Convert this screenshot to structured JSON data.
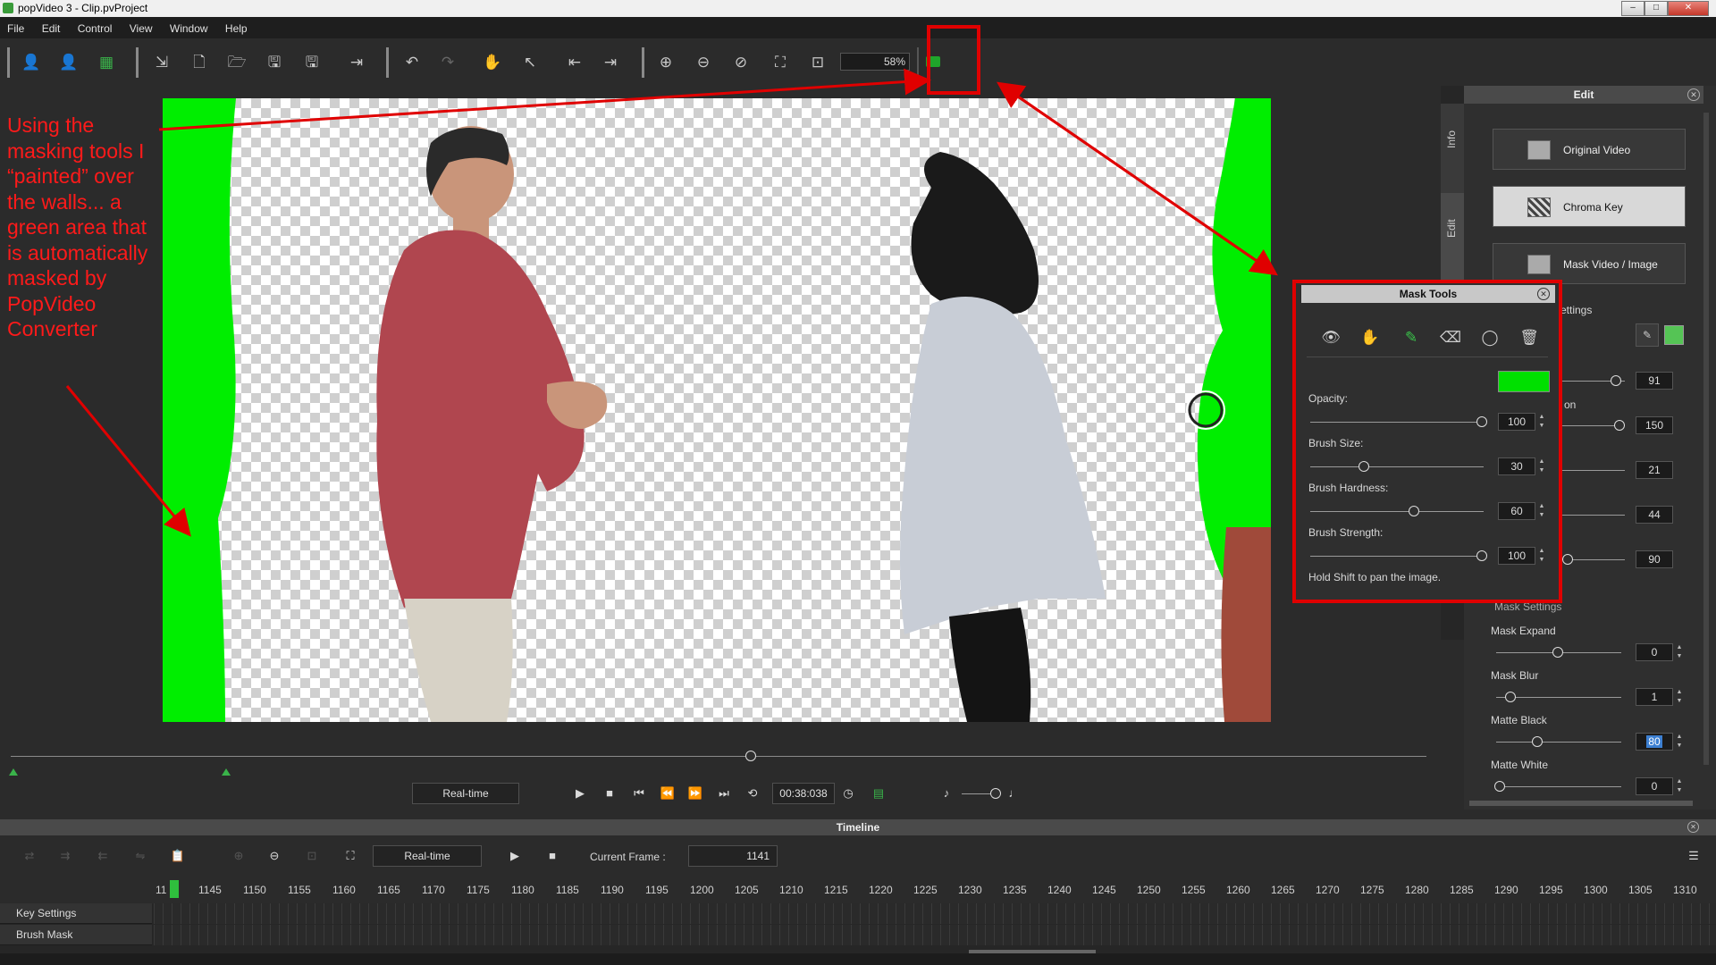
{
  "window": {
    "title": "popVideo 3 - Clip.pvProject"
  },
  "menu": [
    "File",
    "Edit",
    "Control",
    "View",
    "Window",
    "Help"
  ],
  "toolbar": {
    "zoom": "58%"
  },
  "annotation": "Using the masking tools I “painted” over the walls... a green area that is automatically masked by PopVideo Converter",
  "side_tabs": [
    "Info",
    "Edit"
  ],
  "edit_panel": {
    "title": "Edit",
    "buttons": [
      "Original Video",
      "Chroma Key",
      "Mask Video / Image"
    ],
    "hidden_label_fragments": [
      "ettings",
      "on"
    ],
    "key_values": [
      "91",
      "150",
      "21",
      "44",
      "90"
    ],
    "mask_settings_title": "Mask Settings",
    "mask_expand": {
      "label": "Mask Expand",
      "value": "0",
      "pos": 0.45
    },
    "mask_blur": {
      "label": "Mask Blur",
      "value": "1",
      "pos": 0.1
    },
    "matte_black": {
      "label": "Matte Black",
      "value": "80",
      "pos": 0.3
    },
    "matte_white": {
      "label": "Matte White",
      "value": "0",
      "pos": 0.0
    }
  },
  "mask_tools": {
    "title": "Mask Tools",
    "brush_color": "#00e000",
    "opacity": {
      "label": "Opacity:",
      "value": "100",
      "pos": 1.0
    },
    "brush_size": {
      "label": "Brush Size:",
      "value": "30",
      "pos": 0.3
    },
    "brush_hardness": {
      "label": "Brush Hardness:",
      "value": "60",
      "pos": 0.6
    },
    "brush_strength": {
      "label": "Brush Strength:",
      "value": "100",
      "pos": 1.0
    },
    "hint": "Hold Shift to pan the image."
  },
  "transport": {
    "mode": "Real-time",
    "timecode": "00:38:038"
  },
  "timeline": {
    "title": "Timeline",
    "mode": "Real-time",
    "current_frame_label": "Current Frame :",
    "current_frame": "1141",
    "ruler_first": "11",
    "ruler": [
      "1145",
      "1150",
      "1155",
      "1160",
      "1165",
      "1170",
      "1175",
      "1180",
      "1185",
      "1190",
      "1195",
      "1200",
      "1205",
      "1210",
      "1215",
      "1220",
      "1225",
      "1230",
      "1235",
      "1240",
      "1245",
      "1250",
      "1255",
      "1260",
      "1265",
      "1270",
      "1275",
      "1280",
      "1285",
      "1290",
      "1295",
      "1300",
      "1305",
      "1310"
    ],
    "tracks": [
      "Key Settings",
      "Brush Mask"
    ]
  },
  "colors": {
    "accent_red": "#e00000",
    "green_mask": "#00e000"
  }
}
